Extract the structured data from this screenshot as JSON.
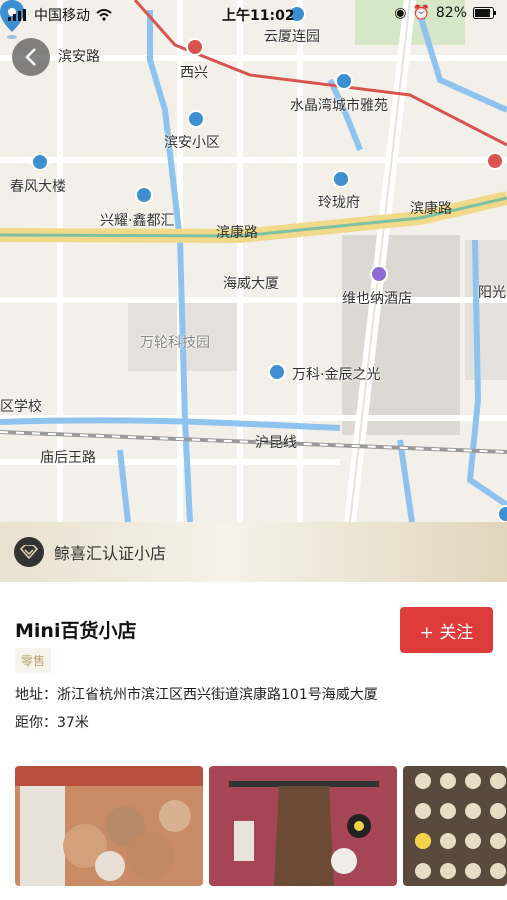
{
  "status_bar": {
    "carrier": "中国移动",
    "time": "上午11:02",
    "battery": "82%"
  },
  "map": {
    "roads": [
      "滨安路",
      "滨康路",
      "滨康路",
      "庙后王路",
      "沪昆线"
    ],
    "labels": {
      "xixing": "西兴",
      "yunxia": "云厦连园",
      "shuijing": "水晶湾城市雅苑",
      "binan": "滨安小区",
      "chunfeng": "春风大楼",
      "xingyao": "兴耀·鑫都汇",
      "linglong": "玲珑府",
      "haiwei": "海威大厦",
      "weiyena": "维也纳酒店",
      "yangguang": "阳光",
      "wanlun": "万轮科技园",
      "wanke": "万科·金辰之光",
      "xuexiao": "区学校"
    }
  },
  "banner": {
    "text": "鲸喜汇认证小店"
  },
  "shop": {
    "name": "Mini百货小店",
    "tag": "零售",
    "follow_label": "+ 关注",
    "address": "地址：浙江省杭州市滨江区西兴街道滨康路101号海威大厦",
    "distance": "距你：37米"
  },
  "colors": {
    "follow_button": "#de3b3b",
    "pin": "#3d8fd1",
    "poi": "#3d8fd1",
    "tag_text": "#b7a271"
  }
}
